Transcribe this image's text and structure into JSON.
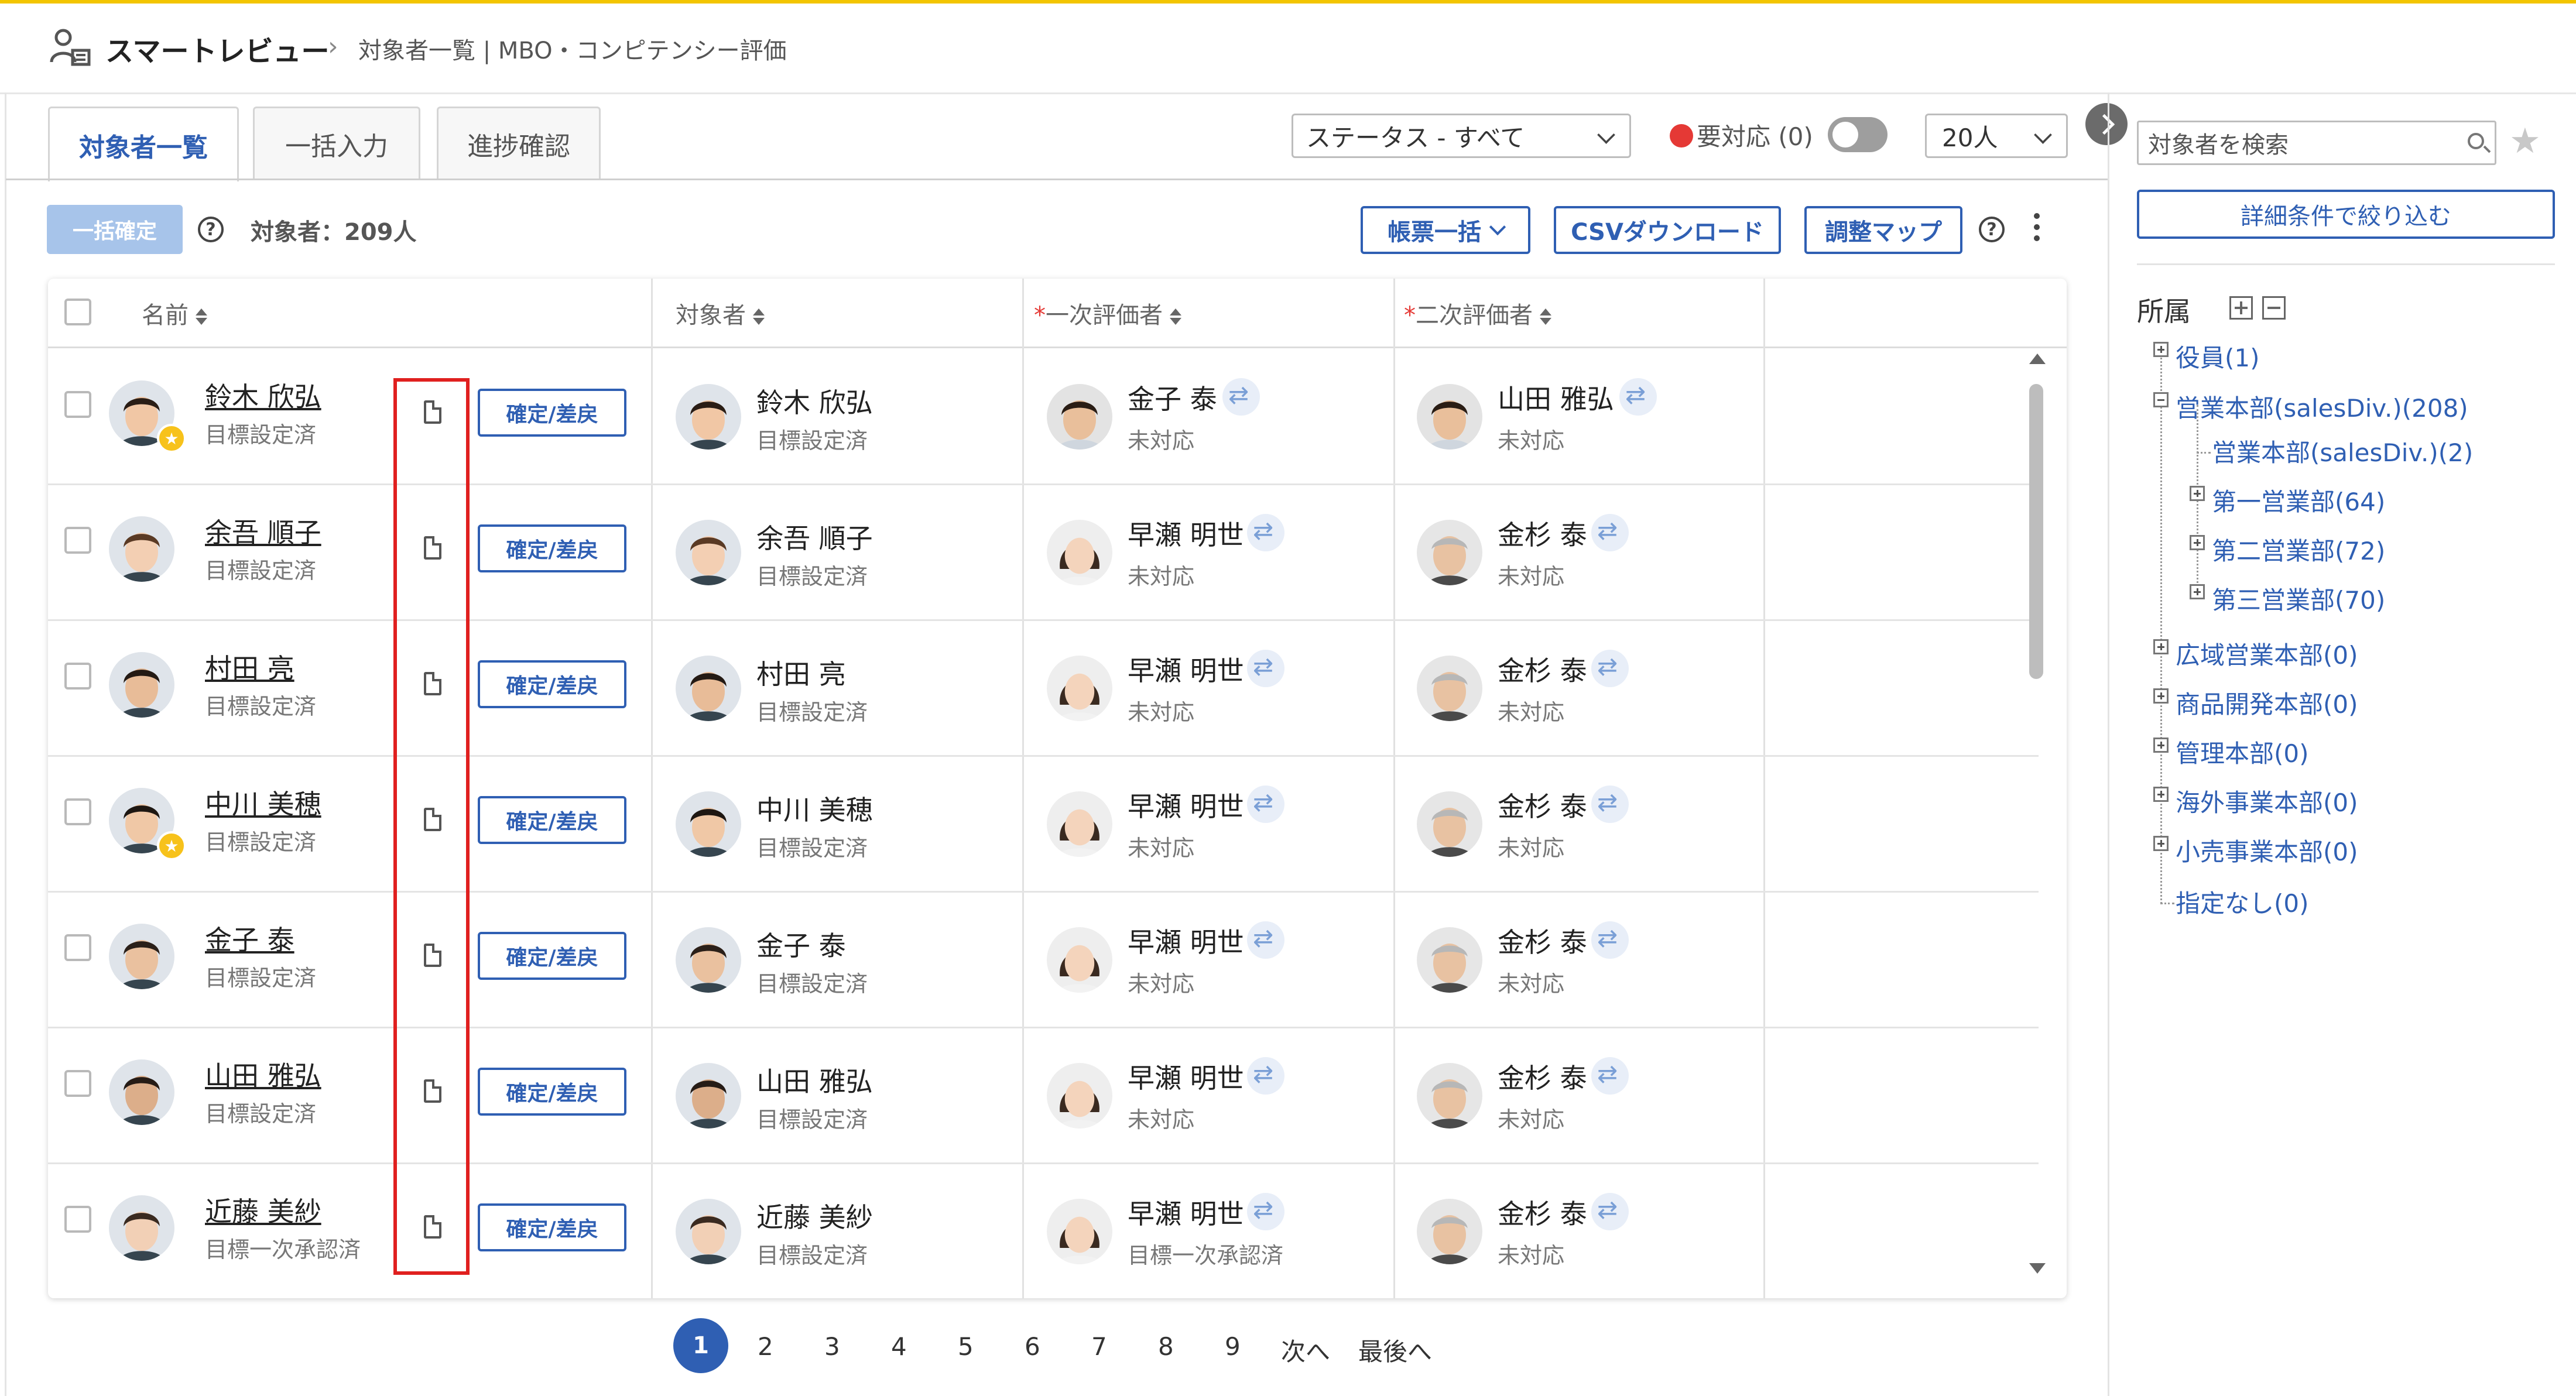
{
  "app": {
    "title": "スマートレビュー",
    "breadcrumb": "対象者一覧 | MBO・コンピテンシー評価"
  },
  "tabs": [
    {
      "label": "対象者一覧",
      "active": true
    },
    {
      "label": "一括入力",
      "active": false
    },
    {
      "label": "進捗確認",
      "active": false
    }
  ],
  "filters": {
    "status_select": "ステータス - すべて",
    "need_action_label": "要対応",
    "need_action_count": "(0)",
    "per_page_select": "20人"
  },
  "toolbar": {
    "bulk_confirm_label": "一括確定",
    "target_count_label": "対象者：209人",
    "forms_bulk_label": "帳票一括",
    "csv_download_label": "CSVダウンロード",
    "adjust_map_label": "調整マップ",
    "help": "?"
  },
  "table": {
    "columns": [
      "名前",
      "対象者",
      "一次評価者",
      "二次評価者"
    ],
    "required_mark": "*",
    "confirm_button_label": "確定/差戻",
    "rows": [
      {
        "name": "鈴木 欣弘",
        "name_status": "目標設定済",
        "target": "鈴木 欣弘",
        "target_status": "目標設定済",
        "first": "金子 泰",
        "first_status": "未対応",
        "second": "山田 雅弘",
        "second_status": "未対応",
        "star": true
      },
      {
        "name": "余吾 順子",
        "name_status": "目標設定済",
        "target": "余吾 順子",
        "target_status": "目標設定済",
        "first": "早瀬 明世",
        "first_status": "未対応",
        "second": "金杉 泰",
        "second_status": "未対応",
        "star": false
      },
      {
        "name": "村田 亮",
        "name_status": "目標設定済",
        "target": "村田 亮",
        "target_status": "目標設定済",
        "first": "早瀬 明世",
        "first_status": "未対応",
        "second": "金杉 泰",
        "second_status": "未対応",
        "star": false
      },
      {
        "name": "中川 美穂",
        "name_status": "目標設定済",
        "target": "中川 美穂",
        "target_status": "目標設定済",
        "first": "早瀬 明世",
        "first_status": "未対応",
        "second": "金杉 泰",
        "second_status": "未対応",
        "star": true
      },
      {
        "name": "金子 泰",
        "name_status": "目標設定済",
        "target": "金子 泰",
        "target_status": "目標設定済",
        "first": "早瀬 明世",
        "first_status": "未対応",
        "second": "金杉 泰",
        "second_status": "未対応",
        "star": false
      },
      {
        "name": "山田 雅弘",
        "name_status": "目標設定済",
        "target": "山田 雅弘",
        "target_status": "目標設定済",
        "first": "早瀬 明世",
        "first_status": "未対応",
        "second": "金杉 泰",
        "second_status": "未対応",
        "star": false
      },
      {
        "name": "近藤 美紗",
        "name_status": "目標一次承認済",
        "target": "近藤 美紗",
        "target_status": "目標設定済",
        "first": "早瀬 明世",
        "first_status": "目標一次承認済",
        "second": "金杉 泰",
        "second_status": "未対応",
        "star": false
      }
    ]
  },
  "pagination": {
    "pages": [
      "1",
      "2",
      "3",
      "4",
      "5",
      "6",
      "7",
      "8",
      "9"
    ],
    "current": "1",
    "next_label": "次へ",
    "last_label": "最後へ"
  },
  "right_panel": {
    "search_placeholder": "対象者を検索",
    "filter_button_label": "詳細条件で絞り込む",
    "affiliation_title": "所属",
    "tree": [
      {
        "label": "役員(1)",
        "level": 0,
        "toggle": "plus"
      },
      {
        "label": "営業本部(salesDiv.)(208)",
        "level": 0,
        "toggle": "minus"
      },
      {
        "label": "営業本部(salesDiv.)(2)",
        "level": 1,
        "toggle": "none"
      },
      {
        "label": "第一営業部(64)",
        "level": 1,
        "toggle": "plus"
      },
      {
        "label": "第二営業部(72)",
        "level": 1,
        "toggle": "plus"
      },
      {
        "label": "第三営業部(70)",
        "level": 1,
        "toggle": "plus"
      },
      {
        "label": "広域営業本部(0)",
        "level": 0,
        "toggle": "plus"
      },
      {
        "label": "商品開発本部(0)",
        "level": 0,
        "toggle": "plus"
      },
      {
        "label": "管理本部(0)",
        "level": 0,
        "toggle": "plus"
      },
      {
        "label": "海外事業本部(0)",
        "level": 0,
        "toggle": "plus"
      },
      {
        "label": "小売事業本部(0)",
        "level": 0,
        "toggle": "plus"
      },
      {
        "label": "指定なし(0)",
        "level": 0,
        "toggle": "none"
      }
    ]
  },
  "colors": {
    "accent": "#2f5fb3",
    "topline": "#f3c500",
    "highlight": "#e0201f",
    "need_dot": "#e53935"
  }
}
